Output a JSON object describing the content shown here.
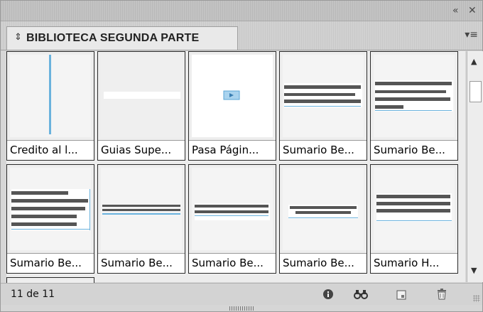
{
  "panel": {
    "title": "BIBLIOTECA SEGUNDA PARTE",
    "collapse_icon": "double-left-arrow-icon",
    "close_icon": "close-icon",
    "menu_icon": "panel-menu-icon"
  },
  "items": [
    {
      "label": "Credito al l...",
      "thumb": "vertical-line"
    },
    {
      "label": "Guias Supe...",
      "thumb": "horizontal-white-bar"
    },
    {
      "label": "Pasa Págin...",
      "thumb": "page-turn-icon"
    },
    {
      "label": "Sumario Be...",
      "thumb": "text-lines-a"
    },
    {
      "label": "Sumario Be...",
      "thumb": "text-lines-b"
    },
    {
      "label": "Sumario Be...",
      "thumb": "text-lines-c"
    },
    {
      "label": "Sumario Be...",
      "thumb": "text-lines-d"
    },
    {
      "label": "Sumario Be...",
      "thumb": "text-lines-e"
    },
    {
      "label": "Sumario Be...",
      "thumb": "text-lines-f"
    },
    {
      "label": "Sumario H...",
      "thumb": "text-lines-g"
    }
  ],
  "status": {
    "count": "11 de 11"
  },
  "colors": {
    "accent_blue": "#6ab2dd",
    "line_dark": "#555555"
  }
}
